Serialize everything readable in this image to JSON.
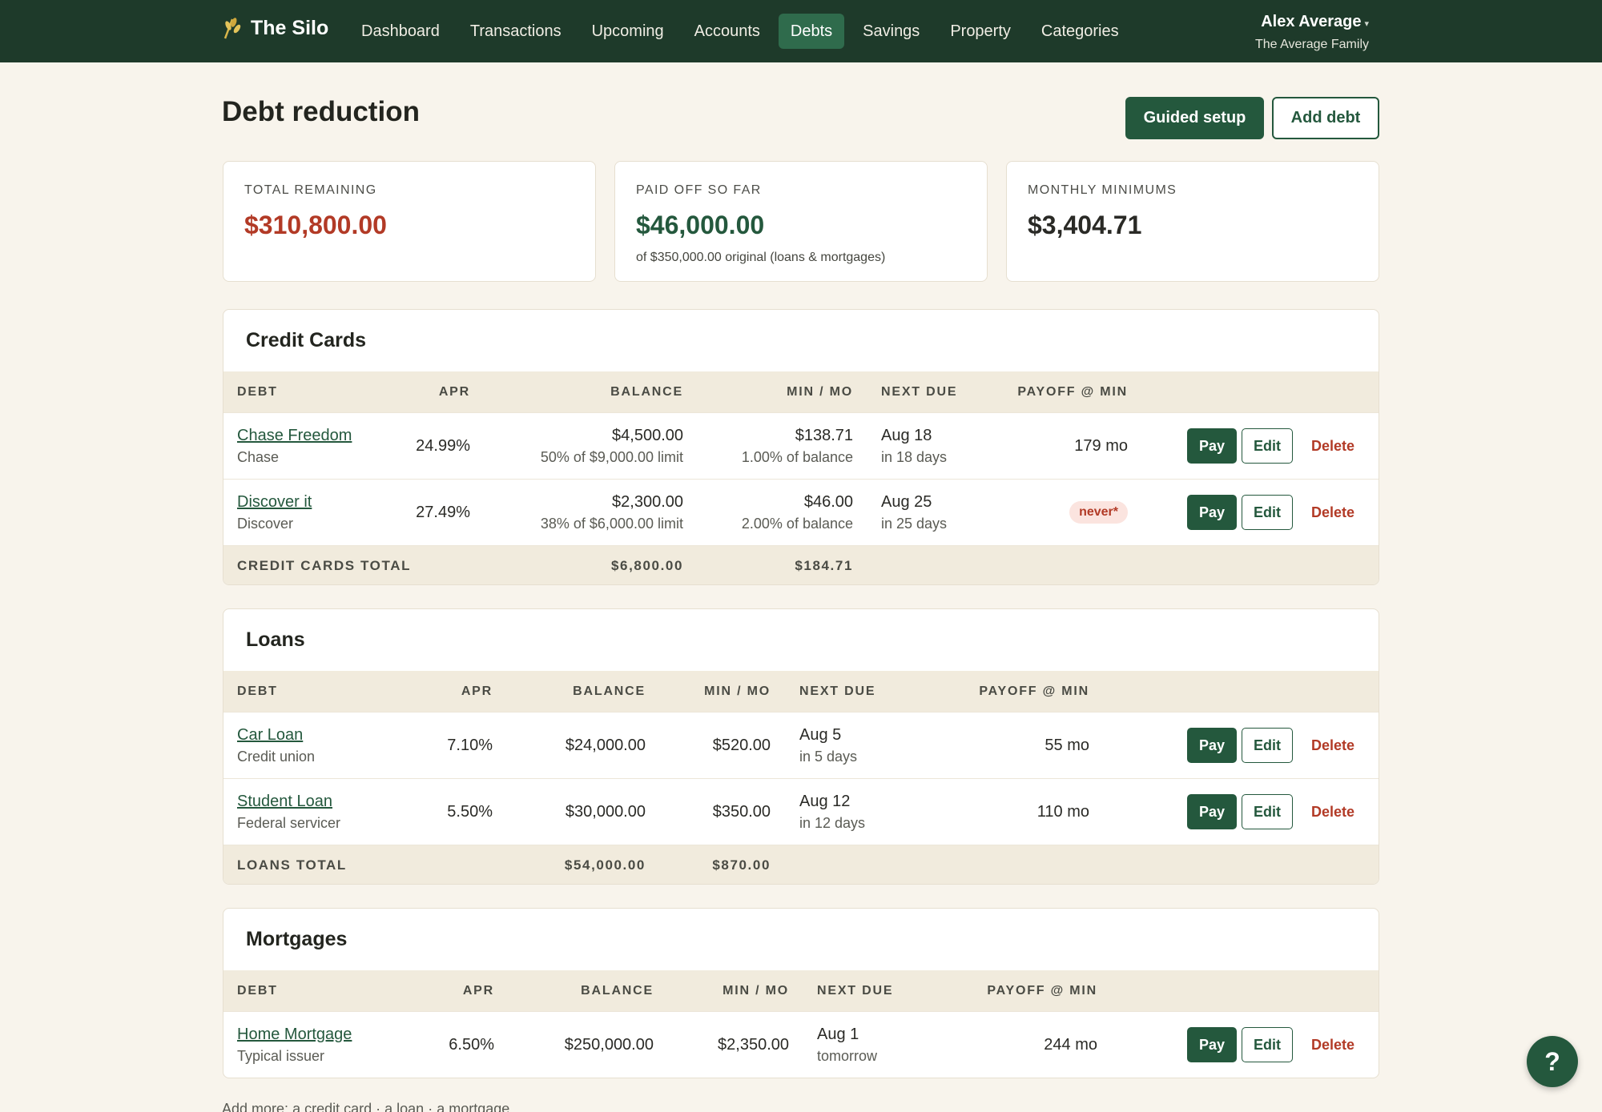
{
  "nav": {
    "brand": "The Silo",
    "links": [
      "Dashboard",
      "Transactions",
      "Upcoming",
      "Accounts",
      "Debts",
      "Savings",
      "Property",
      "Categories"
    ],
    "active": "Debts",
    "user_name": "Alex Average",
    "user_caret": "▾",
    "family": "The Average Family"
  },
  "page": {
    "title": "Debt reduction",
    "guided_setup": "Guided setup",
    "add_debt": "Add debt"
  },
  "stats": {
    "remaining_label": "TOTAL REMAINING",
    "remaining_value": "$310,800.00",
    "paid_label": "PAID OFF SO FAR",
    "paid_value": "$46,000.00",
    "paid_sub": "of $350,000.00 original (loans & mortgages)",
    "minimums_label": "MONTHLY MINIMUMS",
    "minimums_value": "$3,404.71"
  },
  "columns": {
    "debt": "DEBT",
    "apr": "APR",
    "balance": "BALANCE",
    "min": "MIN / MO",
    "due": "NEXT DUE",
    "payoff": "PAYOFF @ MIN"
  },
  "actions": {
    "pay": "Pay",
    "edit": "Edit",
    "delete": "Delete"
  },
  "credit_cards": {
    "title": "Credit Cards",
    "rows": [
      {
        "name": "Chase Freedom",
        "issuer": "Chase",
        "apr": "24.99%",
        "balance": "$4,500.00",
        "limit": "50% of $9,000.00 limit",
        "min": "$138.71",
        "min_sub": "1.00% of balance",
        "due": "Aug 18",
        "due_sub": "in 18 days",
        "payoff": "179 mo"
      },
      {
        "name": "Discover it",
        "issuer": "Discover",
        "apr": "27.49%",
        "balance": "$2,300.00",
        "limit": "38% of $6,000.00 limit",
        "min": "$46.00",
        "min_sub": "2.00% of balance",
        "due": "Aug 25",
        "due_sub": "in 25 days",
        "payoff": "never*"
      }
    ],
    "total_label": "CREDIT CARDS TOTAL",
    "total_balance": "$6,800.00",
    "total_min": "$184.71"
  },
  "loans": {
    "title": "Loans",
    "rows": [
      {
        "name": "Car Loan",
        "issuer": "Credit union",
        "apr": "7.10%",
        "balance": "$24,000.00",
        "min": "$520.00",
        "due": "Aug 5",
        "due_sub": "in 5 days",
        "payoff": "55 mo"
      },
      {
        "name": "Student Loan",
        "issuer": "Federal servicer",
        "apr": "5.50%",
        "balance": "$30,000.00",
        "min": "$350.00",
        "due": "Aug 12",
        "due_sub": "in 12 days",
        "payoff": "110 mo"
      }
    ],
    "total_label": "LOANS TOTAL",
    "total_balance": "$54,000.00",
    "total_min": "$870.00"
  },
  "mortgages": {
    "title": "Mortgages",
    "rows": [
      {
        "name": "Home Mortgage",
        "issuer": "Typical issuer",
        "apr": "6.50%",
        "balance": "$250,000.00",
        "min": "$2,350.00",
        "due": "Aug 1",
        "due_sub": "tomorrow",
        "payoff": "244 mo"
      }
    ]
  },
  "footer": {
    "prefix": "Add more:",
    "credit_card": "a credit card",
    "loan": "a loan",
    "mortgage": "a mortgage",
    "sep": "·"
  },
  "help": "?",
  "colors": {
    "nav_bg": "#1e3a2a",
    "accent": "#24583d",
    "danger": "#b23a26",
    "page_bg": "#f8f4ec"
  }
}
